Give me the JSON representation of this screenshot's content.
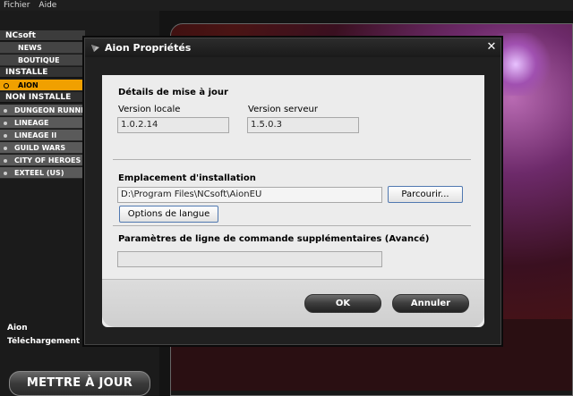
{
  "menubar": {
    "file": "Fichier",
    "help": "Aide"
  },
  "sidebar": {
    "brand": "NCsoft",
    "links": [
      "NEWS",
      "BOUTIQUE"
    ],
    "installed_header": "INSTALLE",
    "installed_games": [
      "AION"
    ],
    "not_installed_header": "NON INSTALLE",
    "not_installed_games": [
      "DUNGEON RUNNERS",
      "LINEAGE",
      "LINEAGE II",
      "GUILD WARS",
      "CITY OF HEROES",
      "EXTEEL (US)"
    ],
    "selected_game": "Aion",
    "download_status": "Téléchargement Disponible",
    "update_button": "METTRE À JOUR",
    "active_color": "#f0a000"
  },
  "dialog": {
    "title": "Aion Propriétés",
    "close": "✕",
    "update_section": "Détails de mise à jour",
    "local_version_label": "Version locale",
    "local_version": "1.0.2.14",
    "server_version_label": "Version serveur",
    "server_version": "1.5.0.3",
    "install_location_label": "Emplacement d'installation",
    "install_path": "D:\\Program Files\\NCsoft\\AionEU",
    "browse_button": "Parcourir...",
    "language_button": "Options de langue",
    "cmdline_label": "Paramètres de ligne de commande supplémentaires (Avancé)",
    "cmdline_value": "",
    "ok_button": "OK",
    "cancel_button": "Annuler"
  }
}
